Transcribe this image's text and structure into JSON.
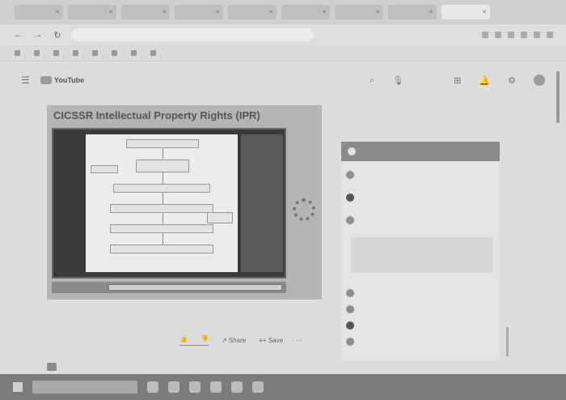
{
  "browser": {
    "tabs": [
      {
        "label": "",
        "active": false
      },
      {
        "label": "",
        "active": false
      },
      {
        "label": "",
        "active": false
      },
      {
        "label": "",
        "active": false
      },
      {
        "label": "",
        "active": false
      },
      {
        "label": "",
        "active": false
      },
      {
        "label": "",
        "active": false
      },
      {
        "label": "",
        "active": false
      },
      {
        "label": "",
        "active": true
      }
    ],
    "url": "",
    "bookmarks": [
      "",
      "",
      "",
      "",
      "",
      "",
      "",
      ""
    ],
    "bookmark_right": ""
  },
  "youtube": {
    "logo_text": "YouTube",
    "search_placeholder": ""
  },
  "video": {
    "title": "CICSSR Intellectual Property Rights (IPR)",
    "progress_label": "",
    "meta_line": "",
    "meta_line2": "",
    "like_count": "",
    "share_label": "Share",
    "save_label": "Save"
  },
  "channel": {
    "name": ""
  },
  "sidebar": {
    "heading": "",
    "panel_header": "",
    "items": [
      "",
      "",
      "",
      "",
      "",
      "",
      "",
      ""
    ],
    "callout": "",
    "footer": ""
  },
  "taskbar": {
    "search_placeholder": "",
    "tray_text": ""
  }
}
